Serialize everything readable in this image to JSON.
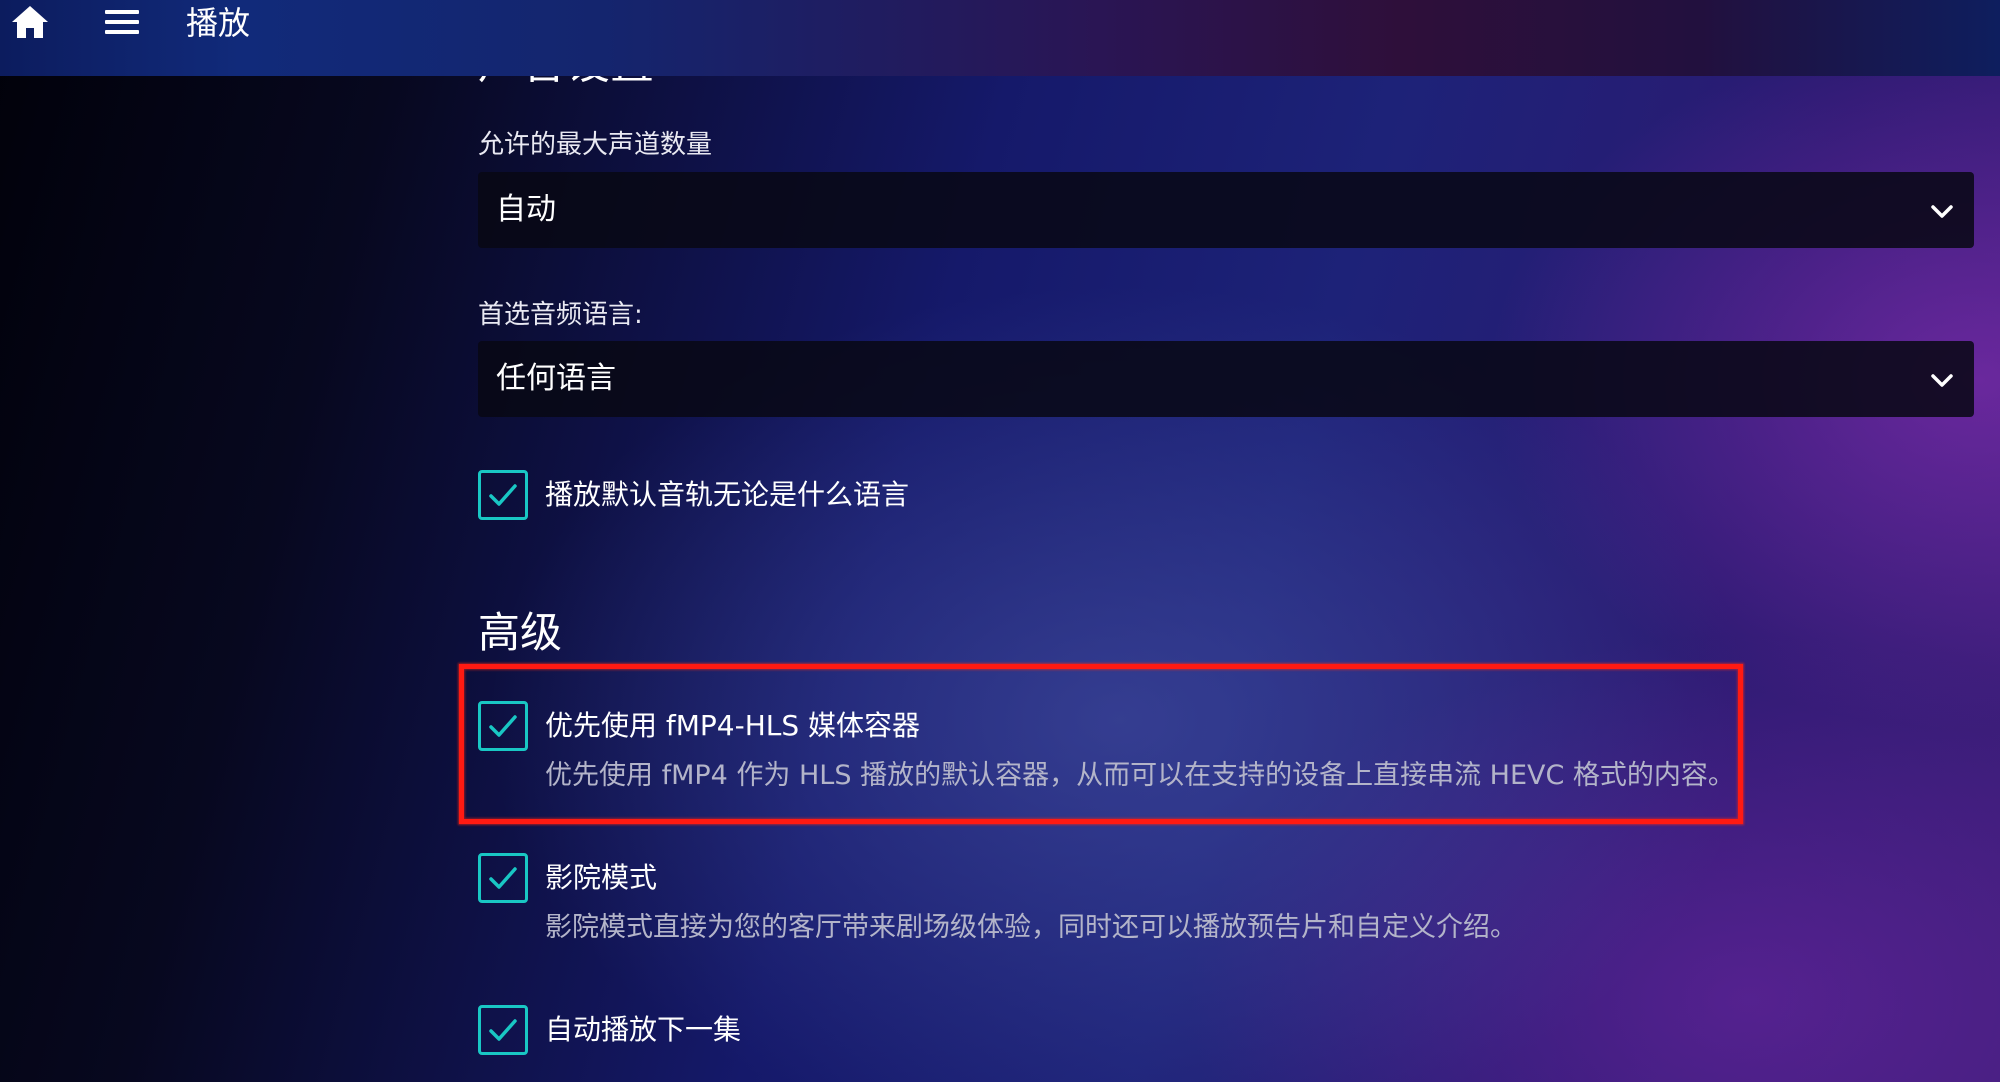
{
  "header": {
    "title": "播放",
    "home_icon": "home-icon",
    "menu_icon": "hamburger-menu-icon"
  },
  "audio_section": {
    "heading": "声音设置",
    "max_channels": {
      "label": "允许的最大声道数量",
      "value": "自动"
    },
    "audio_language": {
      "label": "首选音频语言:",
      "value": "任何语言"
    },
    "play_default_track": {
      "label": "播放默认音轨无论是什么语言",
      "checked": true
    }
  },
  "advanced_section": {
    "heading": "高级",
    "prefer_fmp4": {
      "label": "优先使用 fMP4-HLS 媒体容器",
      "description": "优先使用 fMP4 作为 HLS 播放的默认容器，从而可以在支持的设备上直接串流 HEVC 格式的内容。",
      "checked": true
    },
    "cinema_mode": {
      "label": "影院模式",
      "description": "影院模式直接为您的客厅带来剧场级体验，同时还可以播放预告片和自定义介绍。",
      "checked": true
    },
    "autoplay_next": {
      "label": "自动播放下一集",
      "checked": true
    }
  },
  "colors": {
    "checkbox_accent": "#19c7c4",
    "highlight_annotation": "#ff1a12"
  }
}
